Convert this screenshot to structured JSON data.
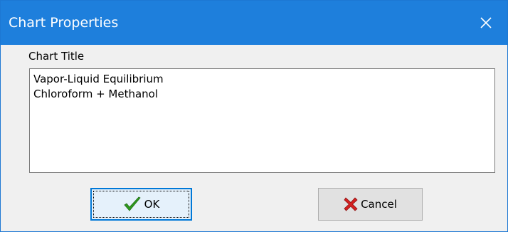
{
  "window": {
    "title": "Chart Properties"
  },
  "form": {
    "title_label": "Chart Title",
    "title_value": "Vapor-Liquid Equilibrium\nChloroform + Methanol"
  },
  "buttons": {
    "ok_label": "OK",
    "cancel_label": "Cancel"
  },
  "icons": {
    "close": "close-icon",
    "ok": "checkmark-icon",
    "cancel": "x-mark-icon"
  },
  "colors": {
    "titlebar": "#1e7fdc",
    "ok_check": "#2e9a1e",
    "cancel_x": "#d42020"
  }
}
